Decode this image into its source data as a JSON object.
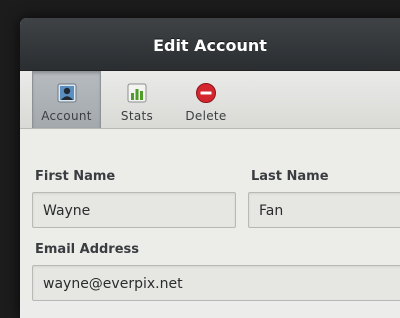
{
  "window": {
    "title": "Edit Account"
  },
  "toolbar": {
    "items": [
      {
        "label": "Account",
        "icon": "account-icon",
        "active": true
      },
      {
        "label": "Stats",
        "icon": "stats-icon",
        "active": false
      },
      {
        "label": "Delete",
        "icon": "delete-icon",
        "active": false
      }
    ]
  },
  "form": {
    "first_name": {
      "label": "First Name",
      "value": "Wayne"
    },
    "last_name": {
      "label": "Last Name",
      "value": "Fan"
    },
    "email": {
      "label": "Email Address",
      "value": "wayne@everpix.net"
    }
  },
  "colors": {
    "titlebar": "#33373a",
    "active_tab": "#aab0b5",
    "delete_red": "#d3262e",
    "stats_green": "#4f9c2a"
  }
}
